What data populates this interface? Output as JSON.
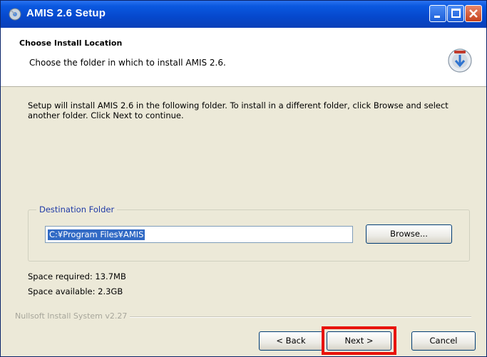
{
  "window": {
    "title": "AMIS 2.6 Setup"
  },
  "header": {
    "title": "Choose Install Location",
    "subtitle": "Choose the folder in which to install AMIS 2.6."
  },
  "main": {
    "description": "Setup will install AMIS 2.6 in the following folder. To install in a different folder, click Browse and select another folder. Click Next to continue.",
    "destination": {
      "group_label": "Destination Folder",
      "path_value": "C:¥Program Files¥AMIS",
      "browse_label": "Browse..."
    },
    "space_required": "Space required: 13.7MB",
    "space_available": "Space available: 2.3GB"
  },
  "footer": {
    "branding": "Nullsoft Install System v2.27",
    "back_label": "< Back",
    "next_label": "Next >",
    "cancel_label": "Cancel"
  },
  "colors": {
    "titlebar": "#0648cc",
    "highlight": "#e8130c",
    "selection": "#316ac5",
    "group_label": "#1f3aa6"
  },
  "icons": [
    "installer-icon",
    "minimize-icon",
    "maximize-icon",
    "close-icon",
    "disc-logo-icon"
  ]
}
